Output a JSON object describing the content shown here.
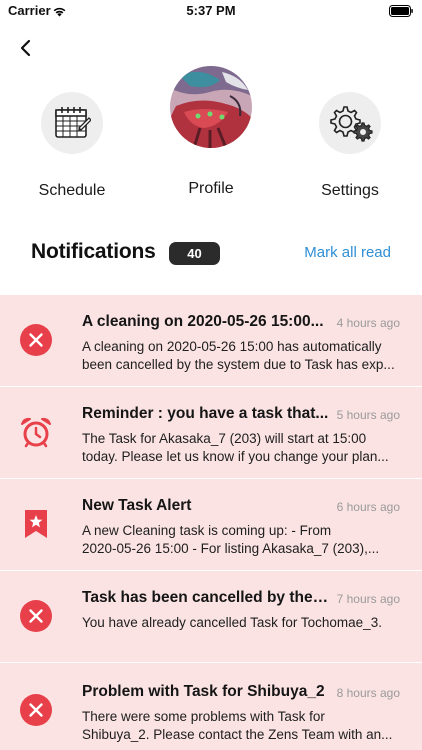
{
  "status_bar": {
    "carrier": "Carrier",
    "time": "5:37 PM"
  },
  "nav": {
    "schedule_label": "Schedule",
    "profile_label": "Profile",
    "settings_label": "Settings"
  },
  "notifications": {
    "title": "Notifications",
    "count": "40",
    "mark_all_label": "Mark all read",
    "items": [
      {
        "icon": "cancel-icon",
        "title": "A cleaning on 2020-05-26 15:00...",
        "time": "4 hours ago",
        "body_line1": "A cleaning on 2020-05-26 15:00 has automatically",
        "body_line2": "been cancelled by the system due to Task has exp..."
      },
      {
        "icon": "alarm-clock-icon",
        "title": "Reminder : you have a task that...",
        "time": "5 hours ago",
        "body_line1": "The Task for Akasaka_7 (203) will start at 15:00",
        "body_line2": "today. Please let us know if  you change your plan..."
      },
      {
        "icon": "bookmark-star-icon",
        "title": "New Task Alert",
        "time": "6 hours ago",
        "body_line1": "A new Cleaning task is coming up: - From",
        "body_line2": "2020-05-26 15:00 - For listing Akasaka_7 (203),..."
      },
      {
        "icon": "cancel-icon",
        "title": "Task has been cancelled by the o...",
        "time": "7 hours ago",
        "body_line1": "You have already cancelled Task for Tochomae_3.",
        "body_line2": ""
      },
      {
        "icon": "cancel-icon",
        "title": "Problem with Task for Shibuya_2",
        "time": "8 hours ago",
        "body_line1": "There were some problems with Task for",
        "body_line2": "Shibuya_2. Please contact the Zens Team with an..."
      }
    ]
  },
  "colors": {
    "accent_red": "#e8404a",
    "link_blue": "#2f8fd6",
    "row_bg": "#fbe3e3",
    "badge_bg": "#2b2b2b"
  }
}
